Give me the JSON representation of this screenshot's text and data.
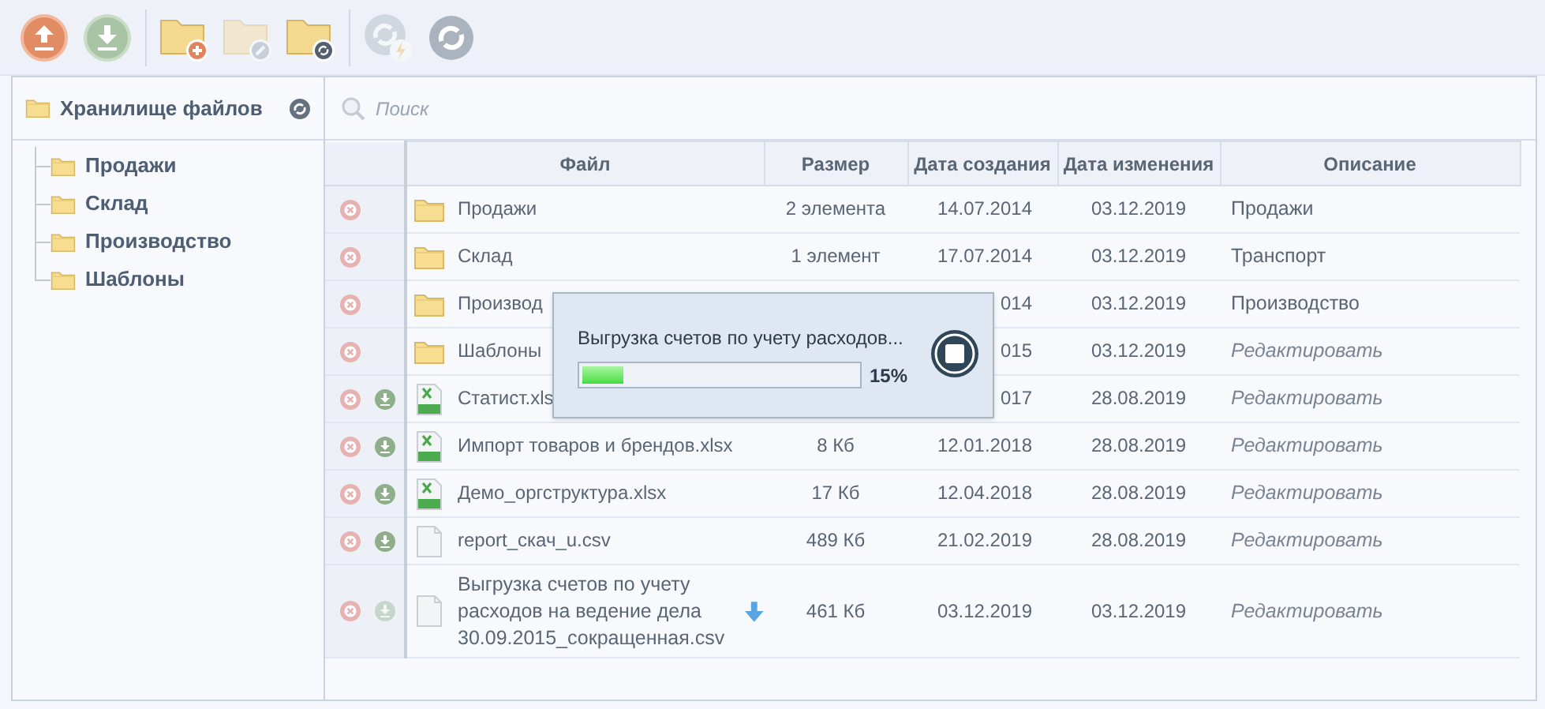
{
  "toolbar": [
    {
      "kind": "upload",
      "disabled": false
    },
    {
      "kind": "download",
      "disabled": false
    },
    {
      "kind": "divider"
    },
    {
      "kind": "folder-add",
      "disabled": false
    },
    {
      "kind": "folder-edit",
      "disabled": true
    },
    {
      "kind": "folder-refresh",
      "disabled": false
    },
    {
      "kind": "divider"
    },
    {
      "kind": "refresh-flash",
      "disabled": true
    },
    {
      "kind": "refresh",
      "disabled": false
    }
  ],
  "sidebar": {
    "title": "Хранилище файлов",
    "items": [
      {
        "label": "Продажи"
      },
      {
        "label": "Склад"
      },
      {
        "label": "Производство"
      },
      {
        "label": "Шаблоны"
      }
    ]
  },
  "search": {
    "placeholder": "Поиск"
  },
  "table": {
    "columns": [
      "Файл",
      "Размер",
      "Дата создания",
      "Дата изменения",
      "Описание"
    ],
    "rows": [
      {
        "kind": "folder",
        "name": "Продажи",
        "size": "2 элемента",
        "created": "14.07.2014",
        "modified": "03.12.2019",
        "description": "Продажи",
        "hint": false
      },
      {
        "kind": "folder",
        "name": "Склад",
        "size": "1 элемент",
        "created": "17.07.2014",
        "modified": "03.12.2019",
        "description": "Транспорт",
        "hint": false
      },
      {
        "kind": "folder",
        "name": "Производ",
        "created": "014",
        "modified": "03.12.2019",
        "description": "Производство",
        "hint": false
      },
      {
        "kind": "folder",
        "name": "Шаблоны",
        "created": "015",
        "modified": "03.12.2019",
        "description": "Редактировать",
        "hint": true
      },
      {
        "kind": "xlsx",
        "name": "Статист.xls",
        "created": "017",
        "modified": "28.08.2019",
        "description": "Редактировать",
        "hint": true,
        "download_disabled": false,
        "downloading": false
      },
      {
        "kind": "xlsx",
        "name": "Импорт товаров и брендов.xlsx",
        "size": "8 Кб",
        "created": "12.01.2018",
        "modified": "28.08.2019",
        "description": "Редактировать",
        "hint": true,
        "download_disabled": false,
        "downloading": false
      },
      {
        "kind": "xlsx",
        "name": "Демо_оргструктура.xlsx",
        "size": "17 Кб",
        "created": "12.04.2018",
        "modified": "28.08.2019",
        "description": "Редактировать",
        "hint": true,
        "download_disabled": false,
        "downloading": false
      },
      {
        "kind": "csv",
        "name": "report_скач_u.csv",
        "size": "489 Кб",
        "created": "21.02.2019",
        "modified": "28.08.2019",
        "description": "Редактировать",
        "hint": true,
        "download_disabled": false,
        "downloading": false
      },
      {
        "kind": "csv",
        "name": "Выгрузка счетов по учету расходов на ведение дела 30.09.2015_сокращенная.csv",
        "size": "461 Кб",
        "created": "03.12.2019",
        "modified": "03.12.2019",
        "description": "Редактировать",
        "hint": true,
        "download_disabled": true,
        "downloading": true
      }
    ]
  },
  "progress_dialog": {
    "message": "Выгрузка счетов по учету расходов...",
    "level": 0.15,
    "reading": "15%"
  }
}
